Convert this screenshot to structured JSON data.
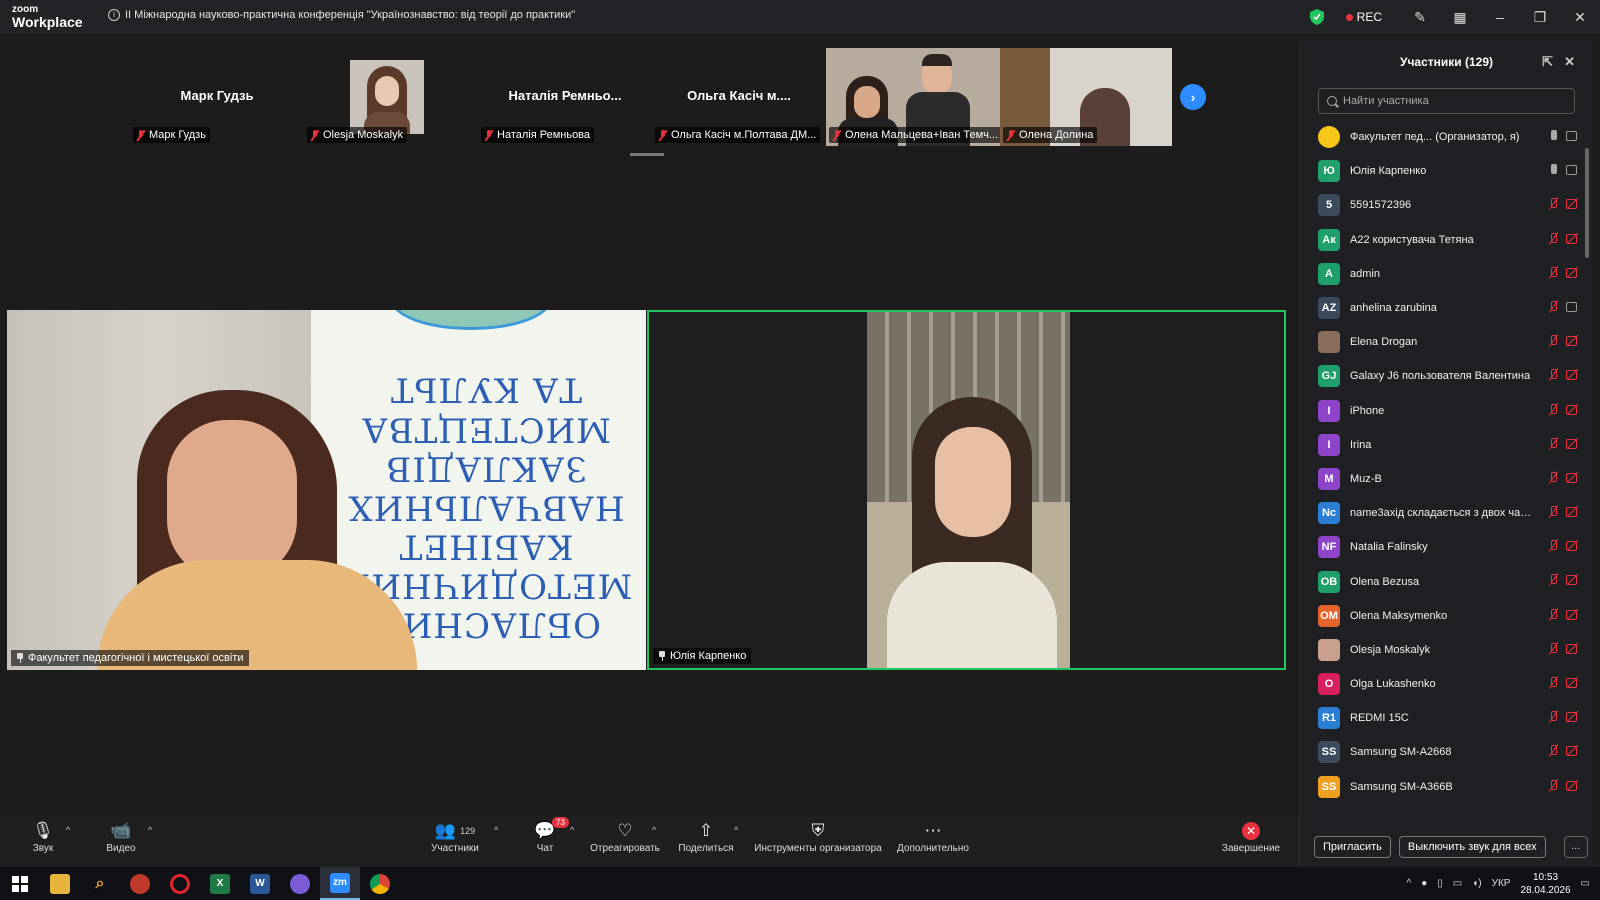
{
  "app": {
    "logo_line1": "zoom",
    "logo_line2": "Workplace",
    "meeting_title": "ІІ Міжнародна науково-практична конференція \"Українознавство: від теорії до практики\"",
    "rec_label": "REC"
  },
  "strip": {
    "thumbs": [
      {
        "big_name": "Марк Гудзь",
        "tag": "Марк Гудзь"
      },
      {
        "big_name": "",
        "tag": "Olesja Moskalyk"
      },
      {
        "big_name": "Наталія Ремньо...",
        "tag": "Наталія Ремньова"
      },
      {
        "big_name": "Ольга Касіч м....",
        "tag": "Ольга Касіч м.Полтава ДМ..."
      },
      {
        "big_name": "",
        "tag": "Олена Мальцева+Іван Темч..."
      },
      {
        "big_name": "",
        "tag": "Олена Долина"
      }
    ]
  },
  "main_tiles": {
    "left_label": "Факультет педагогічної і мистецької освіти",
    "right_label": "Юлія Карпенко",
    "banner_lines": [
      "ОБЛАСНИЙ",
      "МЕТОДИЧНИЙ",
      "КАБІНЕТ",
      "НАВЧАЛЬНИХ",
      "ЗАКЛАДІВ",
      "МИСТЕЦТВА",
      "ТА КУЛЬТ"
    ]
  },
  "participants": {
    "title": "Участники (129)",
    "search_placeholder": "Найти участника",
    "items": [
      {
        "initials": "",
        "name": "Факультет пед... (Организатор, я)",
        "color": "#f5c518",
        "mic": "on",
        "cam": "on"
      },
      {
        "initials": "Ю",
        "name": "Юлія Карпенко",
        "color": "#22a06b",
        "mic": "on",
        "cam": "on"
      },
      {
        "initials": "5",
        "name": "5591572396",
        "color": "#3b4a5c",
        "mic": "off",
        "cam": "off"
      },
      {
        "initials": "Ак",
        "name": "A22 користувача Тетяна",
        "color": "#1fa06b",
        "mic": "off",
        "cam": "off"
      },
      {
        "initials": "A",
        "name": "admin",
        "color": "#1fa06b",
        "mic": "off",
        "cam": "off"
      },
      {
        "initials": "AZ",
        "name": "anhelina zarubina",
        "color": "#3b4a5c",
        "mic": "off",
        "cam": "on"
      },
      {
        "initials": "",
        "name": "Elena Drogan",
        "color": "#8a6d5a",
        "mic": "off",
        "cam": "off"
      },
      {
        "initials": "GJ",
        "name": "Galaxy J6 пользователя Валентина",
        "color": "#1fa06b",
        "mic": "off",
        "cam": "off"
      },
      {
        "initials": "I",
        "name": "iPhone",
        "color": "#8e44c9",
        "mic": "off",
        "cam": "off"
      },
      {
        "initials": "I",
        "name": "Irina",
        "color": "#8e44c9",
        "mic": "off",
        "cam": "off"
      },
      {
        "initials": "M",
        "name": "Muz-B",
        "color": "#8e44c9",
        "mic": "off",
        "cam": "off"
      },
      {
        "initials": "Nc",
        "name": "name3axід складається з двох части...",
        "color": "#2a7fd4",
        "mic": "off",
        "cam": "off"
      },
      {
        "initials": "NF",
        "name": "Natalia Falinsky",
        "color": "#8e44c9",
        "mic": "off",
        "cam": "off"
      },
      {
        "initials": "OB",
        "name": "Olena Bezusa",
        "color": "#1fa06b",
        "mic": "off",
        "cam": "off"
      },
      {
        "initials": "OM",
        "name": "Olena Maksymenko",
        "color": "#e5652d",
        "mic": "off",
        "cam": "off"
      },
      {
        "initials": "",
        "name": "Olesja Moskalyk",
        "color": "#c9a08f",
        "mic": "off",
        "cam": "off"
      },
      {
        "initials": "O",
        "name": "Olga Lukashenko",
        "color": "#d61f5e",
        "mic": "off",
        "cam": "off"
      },
      {
        "initials": "R1",
        "name": "REDMI 15C",
        "color": "#2a7fd4",
        "mic": "off",
        "cam": "off"
      },
      {
        "initials": "SS",
        "name": "Samsung SM-A2668",
        "color": "#3b4a5c",
        "mic": "off",
        "cam": "off"
      },
      {
        "initials": "SS",
        "name": "Samsung SM-A366B",
        "color": "#f0a020",
        "mic": "off",
        "cam": "off"
      }
    ],
    "invite_label": "Пригласить",
    "mute_all_label": "Выключить звук для всех",
    "more_label": "..."
  },
  "toolbar": {
    "audio": "Звук",
    "video": "Видео",
    "participants": "Участники",
    "participants_count": "129",
    "chat": "Чат",
    "chat_badge": "73",
    "react": "Отреагировать",
    "share": "Поделиться",
    "host_tools": "Инструменты организатора",
    "more": "Дополнительно",
    "end": "Завершение"
  },
  "taskbar": {
    "lang": "УКР",
    "time": "10:53",
    "date": "28.04.2026"
  }
}
